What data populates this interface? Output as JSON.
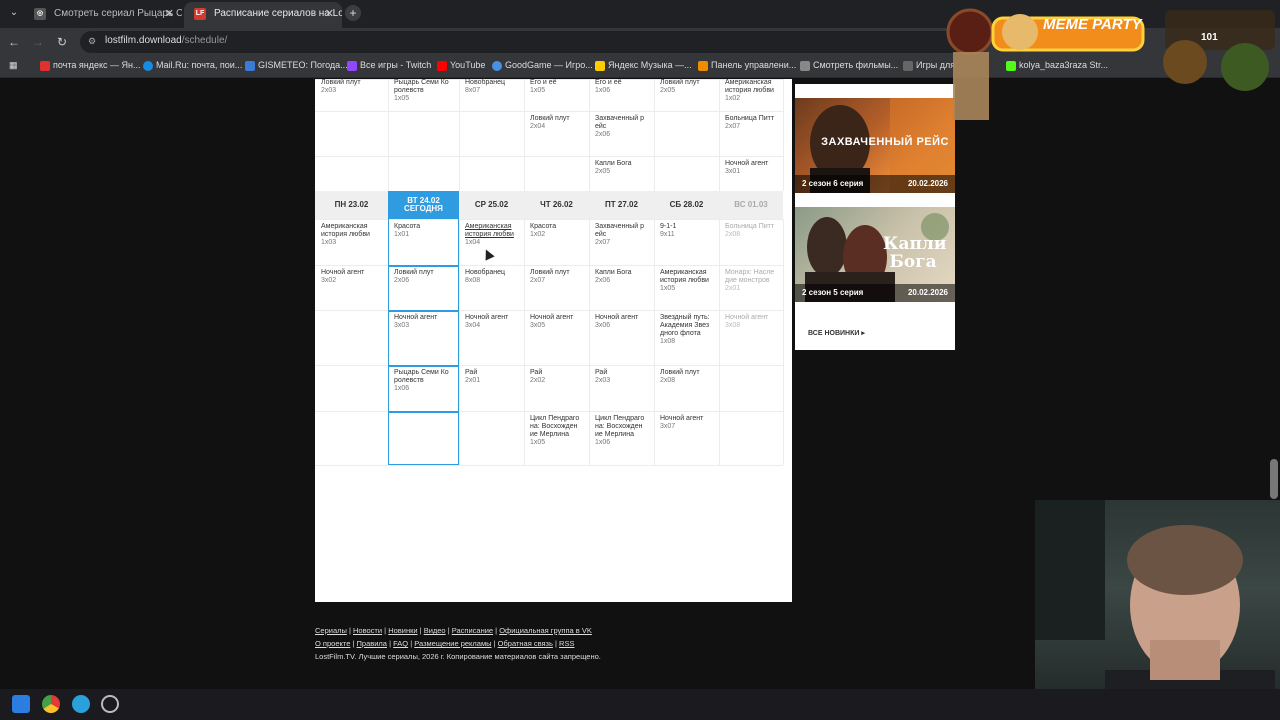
{
  "browser": {
    "tabs": [
      {
        "title": "Смотреть сериал Рыцарь Сем",
        "active": false
      },
      {
        "title": "Расписание сериалов на LostF",
        "active": true
      }
    ],
    "url_host": "lostfilm.download",
    "url_path": "/schedule/",
    "bookmarks": [
      "почта яндекс — Ян...",
      "Mail.Ru: почта, пои...",
      "GISMETEO: Погода...",
      "Все игры - Twitch",
      "YouTube",
      "GoodGame — Игро...",
      "Яндекс Музыка —...",
      "Панель управлени...",
      "Смотреть фильмы...",
      "Игры для",
      "kolya_baza3raza Str..."
    ]
  },
  "schedule": {
    "days": [
      "ПН 23.02",
      "ВТ 24.02",
      "СР 25.02",
      "ЧТ 26.02",
      "ПТ 27.02",
      "СБ 28.02",
      "ВС 01.03"
    ],
    "today_line1": "ВТ 24.02",
    "today_line2": "СЕГОДНЯ",
    "prev_week": [
      [
        {
          "t": "Ловкий плут",
          "e": "2x03"
        },
        {
          "t": "Рыцарь Семи Ко ролевств",
          "e": "1x05"
        },
        {
          "t": "Новобранец",
          "e": "8x07"
        },
        {
          "t": "Его и её",
          "e": "1x05"
        },
        {
          "t": "Его и её",
          "e": "1x06"
        },
        {
          "t": "Ловкий плут",
          "e": "2x05"
        },
        {
          "t": "Американская история любви",
          "e": "1x02"
        }
      ],
      [
        null,
        null,
        null,
        {
          "t": "Ловкий плут",
          "e": "2x04"
        },
        {
          "t": "Захваченный р ейс",
          "e": "2x06"
        },
        null,
        {
          "t": "Больница Питт",
          "e": "2x07"
        }
      ],
      [
        null,
        null,
        null,
        null,
        {
          "t": "Капли Бога",
          "e": "2x05"
        },
        null,
        {
          "t": "Ночной агент",
          "e": "3x01"
        }
      ]
    ],
    "this_week": [
      [
        {
          "t": "Американская история любви",
          "e": "1x03"
        },
        {
          "t": "Красота",
          "e": "1x01"
        },
        {
          "t": "Американская история любви",
          "e": "1x04"
        },
        {
          "t": "Красота",
          "e": "1x02"
        },
        {
          "t": "Захваченный р ейс",
          "e": "2x07"
        },
        {
          "t": "9-1-1",
          "e": "9x11"
        },
        {
          "t": "Больница Питт",
          "e": "2x08"
        }
      ],
      [
        {
          "t": "Ночной агент",
          "e": "3x02"
        },
        {
          "t": "Ловкий плут",
          "e": "2x06"
        },
        {
          "t": "Новобранец",
          "e": "8x08"
        },
        {
          "t": "Ловкий плут",
          "e": "2x07"
        },
        {
          "t": "Капли Бога",
          "e": "2x06"
        },
        {
          "t": "Американская история любви",
          "e": "1x05"
        },
        {
          "t": "Монарх: Насле дие монстров",
          "e": "2x01"
        }
      ],
      [
        null,
        {
          "t": "Ночной агент",
          "e": "3x03"
        },
        {
          "t": "Ночной агент",
          "e": "3x04"
        },
        {
          "t": "Ночной агент",
          "e": "3x05"
        },
        {
          "t": "Ночной агент",
          "e": "3x06"
        },
        {
          "t": "Звездный путь: Академия Звез дного флота",
          "e": "1x08"
        },
        {
          "t": "Ночной агент",
          "e": "3x08"
        }
      ],
      [
        null,
        {
          "t": "Рыцарь Семи Ко ролевств",
          "e": "1x06"
        },
        {
          "t": "Рай",
          "e": "2x01"
        },
        {
          "t": "Рай",
          "e": "2x02"
        },
        {
          "t": "Рай",
          "e": "2x03"
        },
        {
          "t": "Ловкий плут",
          "e": "2x08"
        },
        null
      ],
      [
        null,
        null,
        null,
        {
          "t": "Цикл Пендраго на: Восхожден ие Мерлина",
          "e": "1x05"
        },
        {
          "t": "Цикл Пендраго на: Восхожден ие Мерлина",
          "e": "1x06"
        },
        {
          "t": "Ночной агент",
          "e": "3x07"
        },
        null
      ]
    ]
  },
  "sidebar": {
    "promos": [
      {
        "title": "ЗАХВАЧЕННЫЙ РЕЙС",
        "season": "2 сезон 6 серия",
        "date": "20.02.2026"
      },
      {
        "title": "Капли Бога",
        "season": "2 сезон 5 серия",
        "date": "20.02.2026"
      }
    ],
    "all_new": "ВСЕ НОВИНКИ"
  },
  "footer": {
    "links1": [
      "Сериалы",
      "Новости",
      "Новинки",
      "Видео",
      "Расписание",
      "Официальная группа в VK"
    ],
    "links2": [
      "О проекте",
      "Правила",
      "FAQ",
      "Размещение рекламы",
      "Обратная связь",
      "RSS"
    ],
    "copyright": "LostFilm.TV. Лучшие сериалы, 2026 г. Копирование материалов сайта запрещено."
  },
  "overlay": {
    "brand": "MEME PARTY",
    "counter": "101"
  }
}
